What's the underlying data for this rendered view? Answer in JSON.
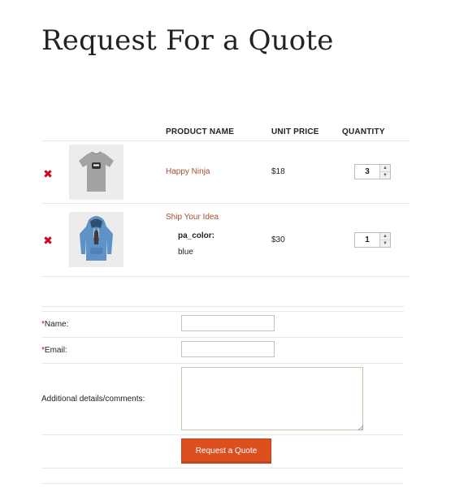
{
  "page": {
    "title": "Request For a Quote"
  },
  "colors": {
    "accent": "#dc4f1e",
    "product_link": "#a0522d",
    "remove": "#d0021b",
    "required": "#d0021b"
  },
  "cart": {
    "columns": {
      "product_name": "PRODUCT NAME",
      "unit_price": "UNIT PRICE",
      "quantity": "QUANTITY"
    },
    "items": [
      {
        "remove_icon": "remove-x-icon",
        "remove_glyph": "✖",
        "thumbnail": "gray-tshirt-ninja-image",
        "name": "Happy Ninja",
        "price": "$18",
        "quantity": "3"
      },
      {
        "remove_icon": "remove-x-icon",
        "remove_glyph": "✖",
        "thumbnail": "blue-hoodie-image",
        "name": "Ship Your Idea",
        "attribute_key": "pa_color:",
        "attribute_value": "blue",
        "price": "$30",
        "quantity": "1"
      }
    ],
    "stepper": {
      "up": "▲",
      "down": "▼"
    }
  },
  "form": {
    "required_mark": "*",
    "name_label": "Name:",
    "email_label": "Email:",
    "comments_label": "Additional details/comments:",
    "submit_label": "Request a Quote"
  }
}
